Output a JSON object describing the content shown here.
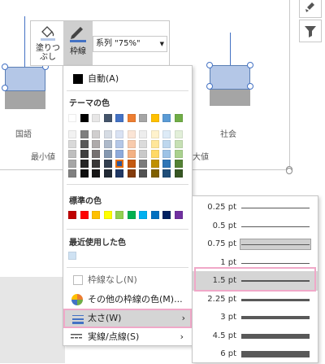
{
  "chart": {
    "categories": [
      "国語",
      "社会"
    ],
    "legend_left": "最小値",
    "legend_right": "大値"
  },
  "toolbar": {
    "fill_label_line1": "塗りつ",
    "fill_label_line2": "ぶし",
    "outline_label": "枠線",
    "series_value": "系列 \"75%\""
  },
  "dropdown": {
    "automatic_label": "自動(A)",
    "theme_colors_heading": "テーマの色",
    "standard_colors_heading": "標準の色",
    "recent_colors_heading": "最近使用した色",
    "no_outline_label": "枠線なし(N)",
    "more_colors_label": "その他の枠線の色(M)...",
    "weight_label": "太さ(W)",
    "dashes_label": "実線/点線(S)",
    "theme_colors": [
      "#ffffff",
      "#000000",
      "#e7e6e6",
      "#44546a",
      "#4472c4",
      "#ed7d31",
      "#a5a5a5",
      "#ffc000",
      "#5b9bd5",
      "#70ad47"
    ],
    "theme_tints": [
      [
        "#f2f2f2",
        "#7f7f7f",
        "#d0cece",
        "#d6dce4",
        "#d9e2f3",
        "#fbe5d6",
        "#ededed",
        "#fff2cc",
        "#ddebf7",
        "#e2efd9"
      ],
      [
        "#d9d9d9",
        "#595959",
        "#aeaaaa",
        "#adb9ca",
        "#b4c7e7",
        "#f8cbad",
        "#dbdbdb",
        "#ffe699",
        "#bdd7ee",
        "#c6e0b4"
      ],
      [
        "#bfbfbf",
        "#404040",
        "#767171",
        "#8497b0",
        "#8eaadb",
        "#f4b183",
        "#c9c9c9",
        "#ffd966",
        "#9dc3e6",
        "#a9d18e"
      ],
      [
        "#a6a6a6",
        "#262626",
        "#3a3838",
        "#333f50",
        "#2f5597",
        "#c55a11",
        "#7b7b7b",
        "#bf9000",
        "#2e75b6",
        "#548235"
      ],
      [
        "#808080",
        "#0d0d0d",
        "#171616",
        "#222a35",
        "#203864",
        "#843c0c",
        "#525252",
        "#7f6000",
        "#1f4e79",
        "#375623"
      ]
    ],
    "standard_colors": [
      "#c00000",
      "#ff0000",
      "#ffc000",
      "#ffff00",
      "#92d050",
      "#00b050",
      "#00b0f0",
      "#0070c0",
      "#002060",
      "#7030a0"
    ],
    "recent_colors": [
      "#cfe2f3"
    ]
  },
  "weights": [
    {
      "label": "0.25 pt",
      "pt": 0.25
    },
    {
      "label": "0.5 pt",
      "pt": 0.5
    },
    {
      "label": "0.75 pt",
      "pt": 0.75
    },
    {
      "label": "1 pt",
      "pt": 1
    },
    {
      "label": "1.5 pt",
      "pt": 1.5
    },
    {
      "label": "2.25 pt",
      "pt": 2.25
    },
    {
      "label": "3 pt",
      "pt": 3
    },
    {
      "label": "4.5 pt",
      "pt": 4.5
    },
    {
      "label": "6 pt",
      "pt": 6
    }
  ],
  "colors": {
    "accent_highlight": "#f0a8c8",
    "box_fill": "#b4c7e7",
    "box_lower": "#a5a5a5"
  }
}
